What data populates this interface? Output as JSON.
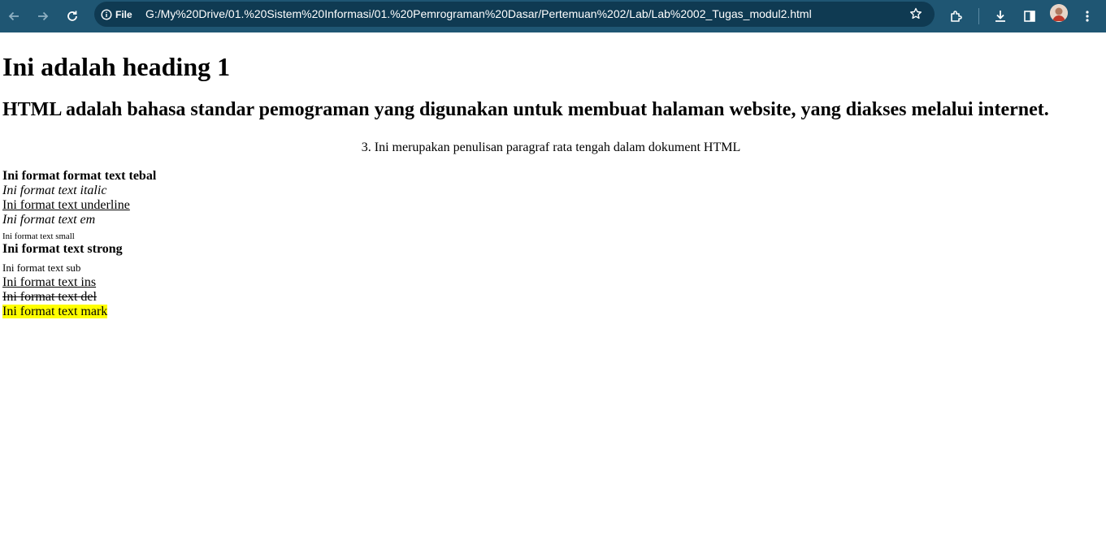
{
  "browser": {
    "chip_label": "File",
    "url": "G:/My%20Drive/01.%20Sistem%20Informasi/01.%20Pemrograman%20Dasar/Pertemuan%202/Lab/Lab%2002_Tugas_modul2.html",
    "icons": [
      "back-icon",
      "forward-icon",
      "reload-icon",
      "info-icon",
      "star-icon",
      "extensions-icon",
      "download-icon",
      "side-panel-icon",
      "avatar",
      "menu-icon"
    ],
    "colors": {
      "toolbar": "#1f5673",
      "omnibox": "#0f3a52"
    }
  },
  "page": {
    "heading1": "Ini adalah heading 1",
    "heading2": "HTML adalah bahasa standar pemograman yang digunakan untuk membuat halaman website, yang diakses melalui internet.",
    "center_paragraph": "3. Ini merupakan penulisan paragraf rata tengah dalam dokument HTML",
    "formats": {
      "bold": "Ini format format text tebal",
      "italic": "Ini format text italic",
      "underline": "Ini format text underline",
      "em": "Ini format text em",
      "small": "Ini format text small",
      "strong": "Ini format text strong",
      "sub": "Ini format text sub",
      "ins": "Ini format text ins",
      "del": "Ini format text del",
      "mark": "Ini format text mark"
    },
    "colors": {
      "mark": "#ffff00"
    }
  }
}
